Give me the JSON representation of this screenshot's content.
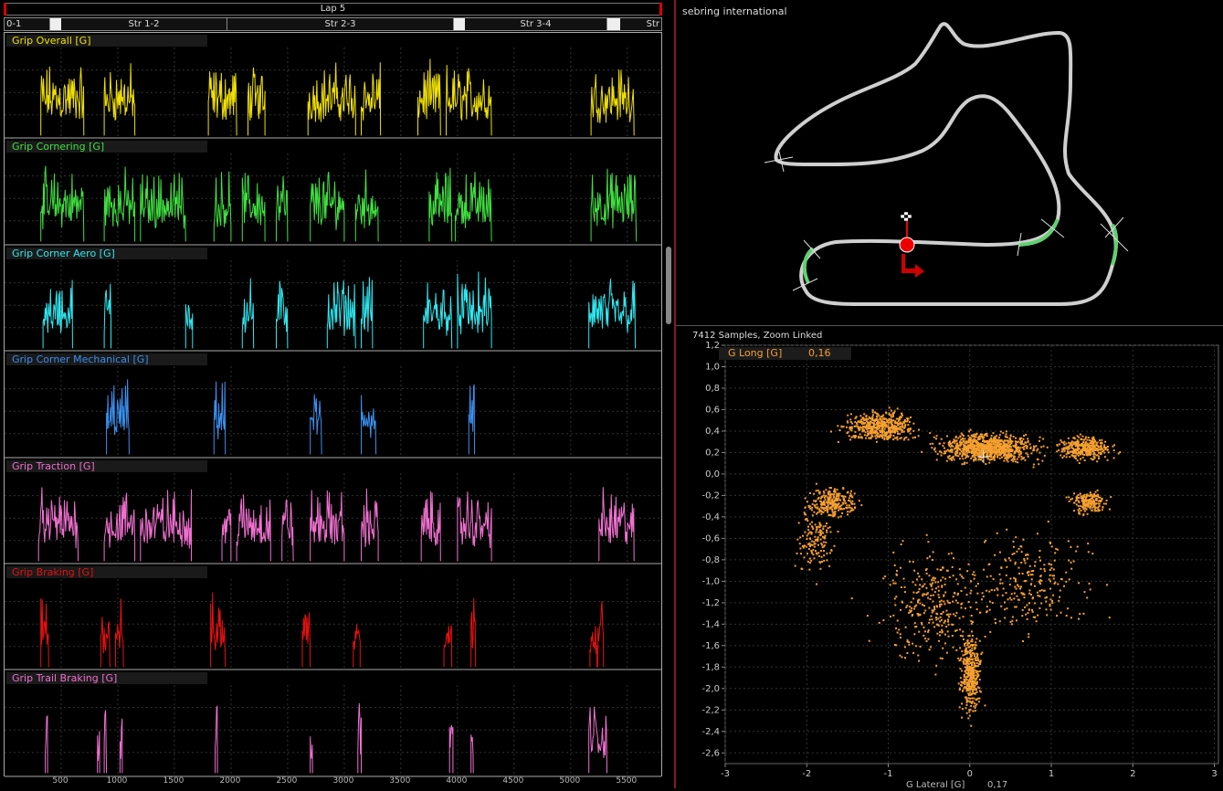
{
  "lap_bar": {
    "label": "Lap 5"
  },
  "sector_bar": {
    "sectors": [
      {
        "label": "0-1"
      },
      {
        "label": "Str 1-2"
      },
      {
        "label": "Str 2-3"
      },
      {
        "label": "Str 3-4"
      },
      {
        "label": "Str"
      }
    ]
  },
  "panels": [
    {
      "title": "Grip Overall [G]",
      "color": "#f0e000"
    },
    {
      "title": "Grip Cornering [G]",
      "color": "#40e040"
    },
    {
      "title": "Grip Corner Aero [G]",
      "color": "#30e8f0"
    },
    {
      "title": "Grip Corner Mechanical [G]",
      "color": "#3a90f0"
    },
    {
      "title": "Grip Traction [G]",
      "color": "#f070d0"
    },
    {
      "title": "Grip Braking [G]",
      "color": "#e81010"
    },
    {
      "title": "Grip Trail Braking [G]",
      "color": "#f070d0"
    }
  ],
  "x_axis": {
    "ticks": [
      "500",
      "1000",
      "1500",
      "2000",
      "2500",
      "3000",
      "3500",
      "4000",
      "4500",
      "5000",
      "5500"
    ]
  },
  "track_map": {
    "title": "sebring international"
  },
  "scatter": {
    "title": "7412 Samples, Zoom Linked",
    "legend_name": "G Long [G]",
    "legend_value": "0,16",
    "x_label": "G Lateral [G]",
    "x_value": "0,17",
    "point_color": "#f5a030",
    "y_ticks": [
      "1,2",
      "1,0",
      "0,8",
      "0,6",
      "0,4",
      "0,2",
      "0,0",
      "-0,2",
      "-0,4",
      "-0,6",
      "-0,8",
      "-1,0",
      "-1,2",
      "-1,4",
      "-1,6",
      "-1,8",
      "-2,0",
      "-2,2",
      "-2,4",
      "-2,6"
    ],
    "x_ticks": [
      "-3",
      "-2",
      "-1",
      "0",
      "1",
      "2",
      "3"
    ]
  }
}
